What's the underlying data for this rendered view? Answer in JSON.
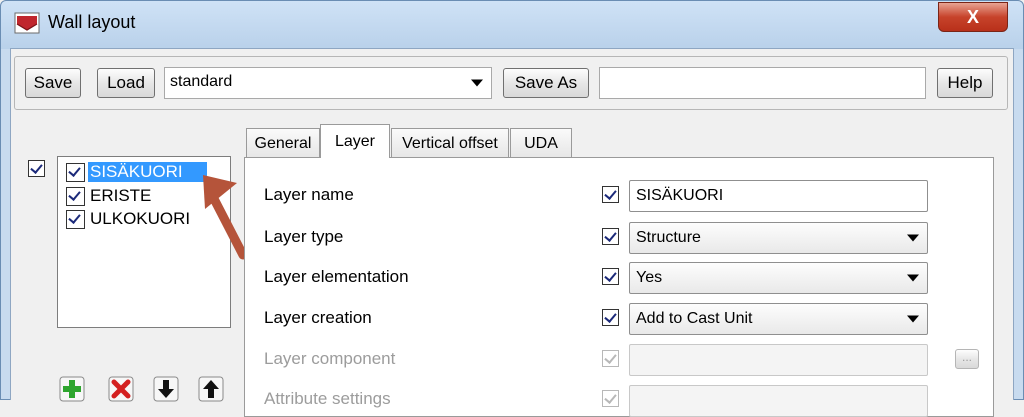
{
  "window": {
    "title": "Wall layout",
    "close_label": "X"
  },
  "toolbar": {
    "save_label": "Save",
    "load_label": "Load",
    "preset_value": "standard",
    "save_as_label": "Save As",
    "save_as_value": "",
    "help_label": "Help"
  },
  "tabs": [
    {
      "label": "General"
    },
    {
      "label": "Layer"
    },
    {
      "label": "Vertical offset"
    },
    {
      "label": "UDA"
    }
  ],
  "layers": [
    {
      "name": "SISÄKUORI",
      "checked": true,
      "selected": true
    },
    {
      "name": "ERISTE",
      "checked": true,
      "selected": false
    },
    {
      "name": "ULKOKUORI",
      "checked": true,
      "selected": false
    }
  ],
  "form": {
    "layer_name": {
      "label": "Layer name",
      "value": "SISÄKUORI"
    },
    "layer_type": {
      "label": "Layer type",
      "value": "Structure"
    },
    "layer_elementation": {
      "label": "Layer elementation",
      "value": "Yes"
    },
    "layer_creation": {
      "label": "Layer creation",
      "value": "Add to Cast Unit"
    },
    "layer_component": {
      "label": "Layer component",
      "value": "",
      "browse_label": "..."
    },
    "attribute_settings": {
      "label": "Attribute settings",
      "value": ""
    }
  },
  "colors": {
    "accent": "#3399ff",
    "arrow": "#b5543a",
    "add": "#2ea52e",
    "delete": "#d42020"
  },
  "icons": [
    "app-icon",
    "close-icon",
    "chevron-down-icon",
    "add-icon",
    "delete-icon",
    "move-down-icon",
    "move-up-icon",
    "annotation-arrow"
  ]
}
